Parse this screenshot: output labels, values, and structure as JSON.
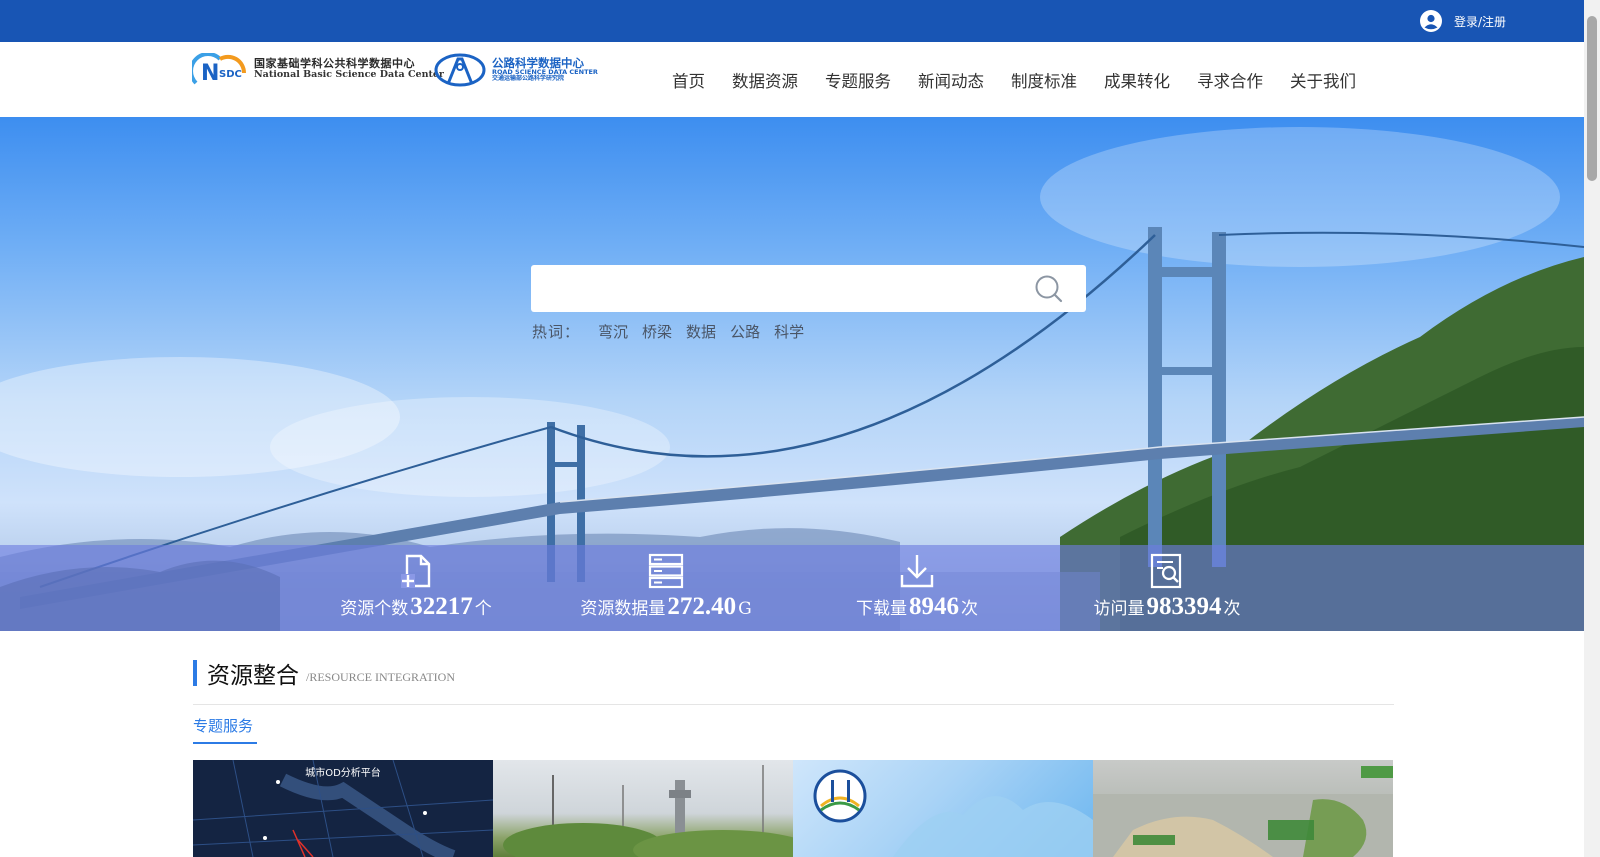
{
  "topbar": {
    "login_label": "登录/注册",
    "background": "#1855b4"
  },
  "header": {
    "logo_left": {
      "abbr": "N SDC",
      "cn": "国家基础学科公共科学数据中心",
      "en": "National Basic Science Data Center"
    },
    "logo_right": {
      "cn": "公路科学数据中心",
      "en": "ROAD SCIENCE DATA CENTER",
      "sub": "交通运输部公路科学研究院"
    },
    "nav": [
      "首页",
      "数据资源",
      "专题服务",
      "新闻动态",
      "制度标准",
      "成果转化",
      "寻求合作",
      "关于我们"
    ]
  },
  "hero": {
    "search": {
      "placeholder": ""
    },
    "hotwords_label": "热词：",
    "hotwords": [
      "弯沉",
      "桥梁",
      "数据",
      "公路",
      "科学"
    ],
    "stats": [
      {
        "icon": "file-add-icon",
        "label": "资源个数",
        "value": "32217",
        "unit": "个"
      },
      {
        "icon": "database-icon",
        "label": "资源数据量",
        "value": "272.40",
        "unit": "G"
      },
      {
        "icon": "download-icon",
        "label": "下载量",
        "value": "8946",
        "unit": "次"
      },
      {
        "icon": "document-search-icon",
        "label": "访问量",
        "value": "983394",
        "unit": "次"
      }
    ]
  },
  "resources": {
    "title": "资源整合",
    "subtitle": "/RESOURCE INTEGRATION",
    "tab": "专题服务",
    "cards": [
      {
        "title": "城市OD分析平台"
      },
      {
        "title": ""
      },
      {
        "title": ""
      },
      {
        "title": ""
      }
    ]
  },
  "colors": {
    "accent": "#2c7be5",
    "topbar": "#1855b4",
    "stats_band": "rgba(110,125,225,0.62)"
  }
}
